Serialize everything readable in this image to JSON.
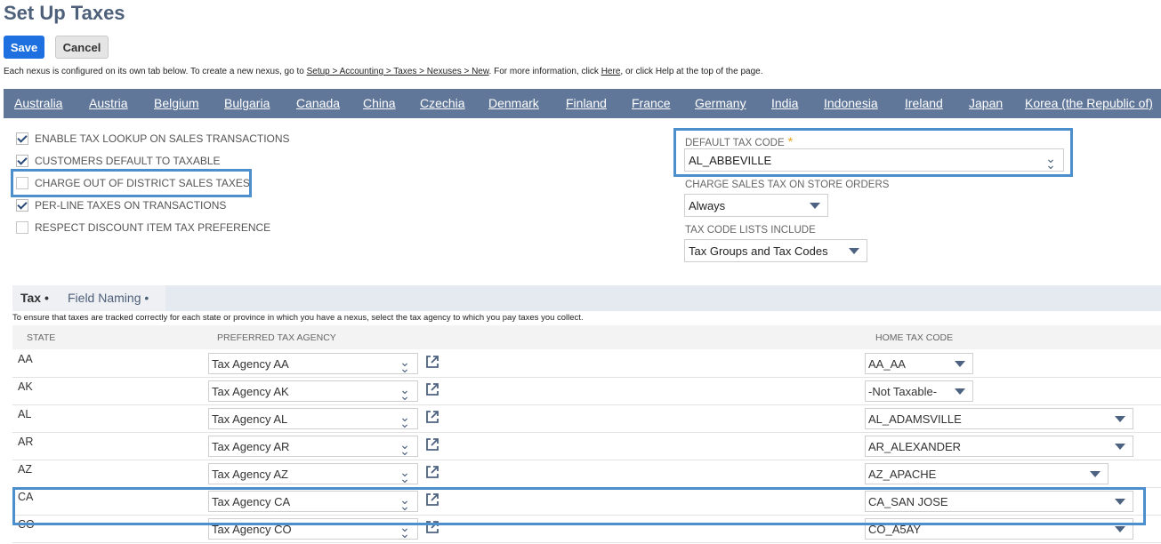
{
  "page": {
    "title": "Set Up Taxes",
    "save_label": "Save",
    "cancel_label": "Cancel",
    "info": {
      "pre": "Each nexus is configured on its own tab below. To create a new nexus, go to ",
      "link1": "Setup > Accounting > Taxes > Nexuses > New",
      "mid": ". For more information, click ",
      "link2": "Here",
      "post": ", or click Help at the top of the page."
    }
  },
  "country_tabs": [
    "Australia",
    "Austria",
    "Belgium",
    "Bulgaria",
    "Canada",
    "China",
    "Czechia",
    "Denmark",
    "Finland",
    "France",
    "Germany",
    "India",
    "Indonesia",
    "Ireland",
    "Japan",
    "Korea (the Republic of)"
  ],
  "options": [
    {
      "label": "ENABLE TAX LOOKUP ON SALES TRANSACTIONS",
      "checked": true
    },
    {
      "label": "CUSTOMERS DEFAULT TO TAXABLE",
      "checked": true
    },
    {
      "label": "CHARGE OUT OF DISTRICT SALES TAXES",
      "checked": false
    },
    {
      "label": "PER-LINE TAXES ON TRANSACTIONS",
      "checked": true
    },
    {
      "label": "RESPECT DISCOUNT ITEM TAX PREFERENCE",
      "checked": false
    }
  ],
  "fields": {
    "default_tax_code_label": "DEFAULT TAX CODE",
    "default_tax_code_required": "*",
    "default_tax_code_value": "AL_ABBEVILLE",
    "store_orders_label": "CHARGE SALES TAX ON STORE ORDERS",
    "store_orders_value": "Always",
    "code_lists_label": "TAX CODE LISTS INCLUDE",
    "code_lists_value": "Tax Groups and Tax Codes"
  },
  "subtabs": {
    "tax": "Tax",
    "field_naming": "Field Naming",
    "dot": "•",
    "note": "To ensure that taxes are tracked correctly for each state or province in which you have a nexus, select the tax agency to which you pay taxes you collect."
  },
  "table": {
    "headers": {
      "state": "STATE",
      "agency": "PREFERRED TAX AGENCY",
      "home": "HOME TAX CODE"
    },
    "rows": [
      {
        "state": "AA",
        "agency": "Tax Agency AA",
        "home": "AA_AA"
      },
      {
        "state": "AK",
        "agency": "Tax Agency AK",
        "home": "-Not Taxable-"
      },
      {
        "state": "AL",
        "agency": "Tax Agency AL",
        "home": "AL_ADAMSVILLE"
      },
      {
        "state": "AR",
        "agency": "Tax Agency AR",
        "home": "AR_ALEXANDER"
      },
      {
        "state": "AZ",
        "agency": "Tax Agency AZ",
        "home": "AZ_APACHE"
      },
      {
        "state": "CA",
        "agency": "Tax Agency CA",
        "home": "CA_SAN JOSE"
      },
      {
        "state": "CO",
        "agency": "Tax Agency CO",
        "home": "CO_A5AY"
      }
    ]
  },
  "colors": {
    "tab_bar": "#607799",
    "highlight": "#4d8fcd",
    "primary": "#1e6fe0"
  }
}
